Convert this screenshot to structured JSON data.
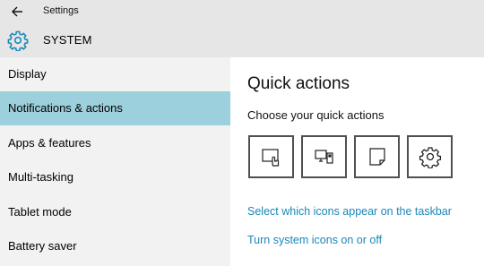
{
  "window": {
    "title": "Settings"
  },
  "header": {
    "title": "SYSTEM",
    "icon": "gear-icon"
  },
  "sidebar": {
    "items": [
      {
        "label": "Display",
        "active": false
      },
      {
        "label": "Notifications & actions",
        "active": true
      },
      {
        "label": "Apps & features",
        "active": false
      },
      {
        "label": "Multi-tasking",
        "active": false
      },
      {
        "label": "Tablet mode",
        "active": false
      },
      {
        "label": "Battery saver",
        "active": false
      }
    ]
  },
  "main": {
    "title": "Quick actions",
    "subtitle": "Choose your quick actions",
    "quick_actions": [
      {
        "icon": "tablet-mode-icon"
      },
      {
        "icon": "project-icon"
      },
      {
        "icon": "note-icon"
      },
      {
        "icon": "settings-icon"
      }
    ],
    "links": [
      "Select which icons appear on the taskbar",
      "Turn system icons on or off"
    ]
  },
  "colors": {
    "accent_selected": "#9cd0dc",
    "link": "#1a88ba",
    "header_bg": "#e6e6e6",
    "sidebar_bg": "#f2f2f2"
  }
}
